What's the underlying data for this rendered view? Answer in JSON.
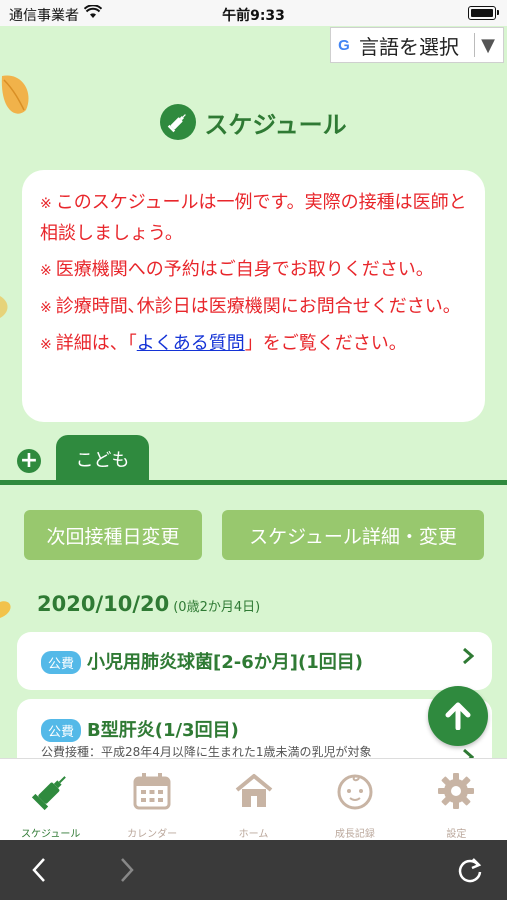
{
  "status_bar": {
    "carrier": "通信事業者",
    "time": "午前9:33"
  },
  "translate": {
    "g": "G",
    "label": "言語を選択",
    "arrow": "▼"
  },
  "page": {
    "title": "スケジュール"
  },
  "notice": {
    "mark": "※",
    "lines": [
      "このスケジュールは一例です。実際の接種は医師と相談しましょう。",
      "医療機関への予約はご自身でお取りください。",
      "診療時間､休診日は医療機関にお問合せください。"
    ],
    "last_prefix": "詳細は、「",
    "last_link": "よくある質問",
    "last_suffix": "」をご覧ください。"
  },
  "tabs": {
    "add": "+",
    "active": "こども"
  },
  "actions": {
    "next_change": "次回接種日変更",
    "detail_change": "スケジュール詳細・変更"
  },
  "date": {
    "value": "2020/10/20",
    "age": "(0歳2か月4日)"
  },
  "items": [
    {
      "badge": "公費",
      "name": "小児用肺炎球菌[2-6か月](1回目)",
      "note": ""
    },
    {
      "badge": "公費",
      "name": "B型肝炎(1/3回目)",
      "note": "公費接種：平成28年4月以降に生まれた1歳未満の乳児が対象"
    }
  ],
  "tabbar": [
    {
      "label": "スケジュール",
      "icon": "syringe-icon",
      "active": true
    },
    {
      "label": "カレンダー",
      "icon": "calendar-icon",
      "active": false
    },
    {
      "label": "ホーム",
      "icon": "home-icon",
      "active": false
    },
    {
      "label": "成長記録",
      "icon": "baby-face-icon",
      "active": false
    },
    {
      "label": "設定",
      "icon": "gear-icon",
      "active": false
    }
  ],
  "colors": {
    "accent": "#2f8a3e",
    "background": "#d8f5d0",
    "button": "#98c86e",
    "warning": "#e8262b",
    "badge": "#54b9e8"
  }
}
